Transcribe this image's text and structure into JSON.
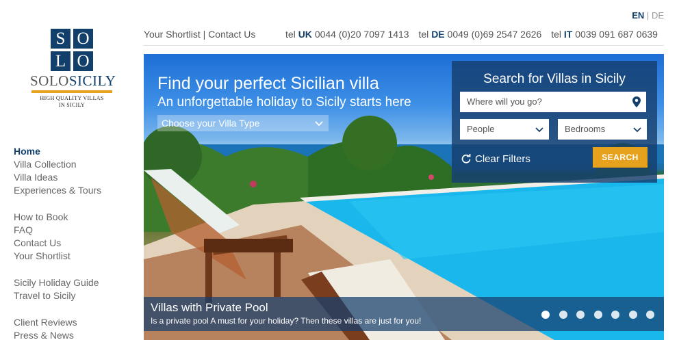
{
  "brand": {
    "logo_letters": [
      "S",
      "O",
      "L",
      "O"
    ],
    "name_part1": "SOLO",
    "name_part2": "SICILY",
    "tagline_line1": "HIGH QUALITY VILLAS",
    "tagline_line2": "IN SICILY",
    "color": "#13406b",
    "accent": "#e6a11d"
  },
  "lang": {
    "active": "EN",
    "separator": "|",
    "other": "DE"
  },
  "topbar": {
    "shortlist": "Your Shortlist",
    "separator": "|",
    "contact": "Contact Us",
    "phones": [
      {
        "prefix": "tel",
        "country": "UK",
        "number": "0044 (0)20 7097 1413"
      },
      {
        "prefix": "tel",
        "country": "DE",
        "number": "0049 (0)69 2547 2626"
      },
      {
        "prefix": "tel",
        "country": "IT",
        "number": "0039 091 687 0639"
      }
    ]
  },
  "sidebar": {
    "groups": [
      [
        "Home",
        "Villa Collection",
        "Villa Ideas",
        "Experiences & Tours"
      ],
      [
        "How to Book",
        "FAQ",
        "Contact Us",
        "Your Shortlist"
      ],
      [
        "Sicily Holiday Guide",
        "Travel to Sicily"
      ],
      [
        "Client Reviews",
        "Press & News"
      ]
    ],
    "active": "Home"
  },
  "hero": {
    "title": "Find your perfect Sicilian villa",
    "subtitle": "An unforgettable holiday to Sicily starts here",
    "villa_type_label": "Choose your Villa Type"
  },
  "search": {
    "title": "Search for Villas in Sicily",
    "where_placeholder": "Where will you go?",
    "people_label": "People",
    "bedrooms_label": "Bedrooms",
    "clear_label": "Clear Filters",
    "button_label": "SEARCH",
    "pin_icon": "map-pin-icon",
    "clear_icon": "refresh-icon"
  },
  "caption": {
    "title": "Villas with Private Pool",
    "text": "Is a private pool A must for your holiday? Then these villas are just for you!",
    "slide_count": 7,
    "active_slide": 1
  }
}
